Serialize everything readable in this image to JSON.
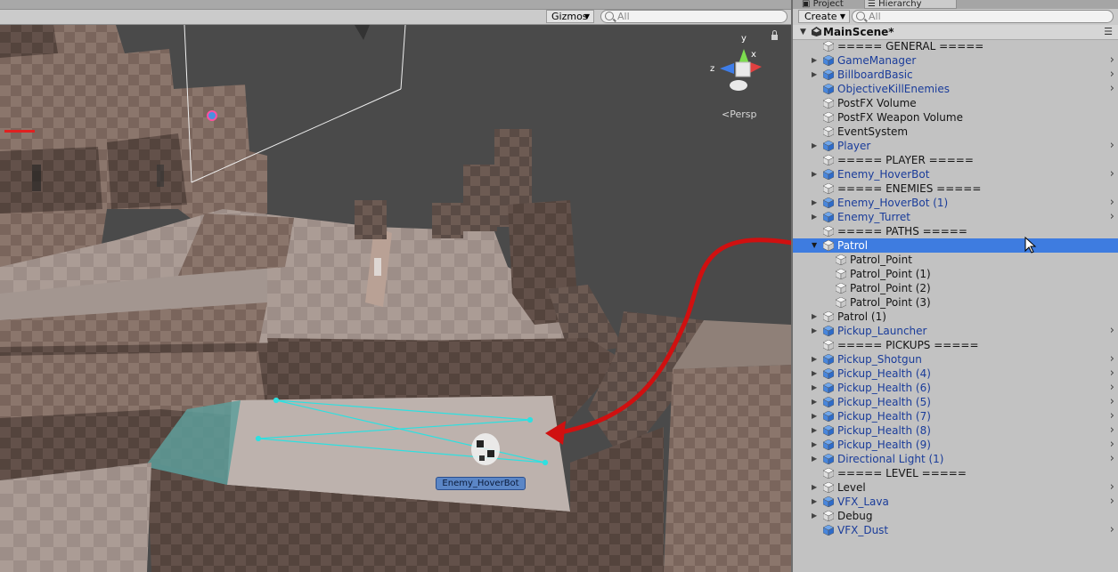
{
  "scene_panel": {
    "gizmos_label": "Gizmos",
    "search_placeholder": "All",
    "persp_label": "Persp",
    "axis_labels": {
      "y": "y",
      "z": "z",
      "x": "x"
    },
    "selected_object_label": "Enemy_HoverBot"
  },
  "hierarchy_panel": {
    "tabs": [
      {
        "label": "Project"
      },
      {
        "label": "Hierarchy"
      }
    ],
    "create_label": "Create",
    "search_placeholder": "All",
    "scene_name": "MainScene*",
    "rows": [
      {
        "label": "===== GENERAL =====",
        "type": "plain",
        "depth": 0,
        "fold": "none",
        "chevron": false,
        "selected": false
      },
      {
        "label": "GameManager",
        "type": "prefab",
        "depth": 0,
        "fold": "closed",
        "chevron": true,
        "selected": false
      },
      {
        "label": "BillboardBasic",
        "type": "prefab",
        "depth": 0,
        "fold": "closed",
        "chevron": true,
        "selected": false
      },
      {
        "label": "ObjectiveKillEnemies",
        "type": "prefab",
        "depth": 0,
        "fold": "none",
        "chevron": true,
        "selected": false
      },
      {
        "label": "PostFX Volume",
        "type": "plain",
        "depth": 0,
        "fold": "none",
        "chevron": false,
        "selected": false
      },
      {
        "label": "PostFX Weapon Volume",
        "type": "plain",
        "depth": 0,
        "fold": "none",
        "chevron": false,
        "selected": false
      },
      {
        "label": "EventSystem",
        "type": "plain",
        "depth": 0,
        "fold": "none",
        "chevron": false,
        "selected": false
      },
      {
        "label": "Player",
        "type": "prefab",
        "depth": 0,
        "fold": "closed",
        "chevron": true,
        "selected": false
      },
      {
        "label": "===== PLAYER =====",
        "type": "plain",
        "depth": 0,
        "fold": "none",
        "chevron": false,
        "selected": false
      },
      {
        "label": "Enemy_HoverBot",
        "type": "prefab",
        "depth": 0,
        "fold": "closed",
        "chevron": true,
        "selected": false
      },
      {
        "label": "===== ENEMIES =====",
        "type": "plain",
        "depth": 0,
        "fold": "none",
        "chevron": false,
        "selected": false
      },
      {
        "label": "Enemy_HoverBot (1)",
        "type": "prefab",
        "depth": 0,
        "fold": "closed",
        "chevron": true,
        "selected": false
      },
      {
        "label": "Enemy_Turret",
        "type": "prefab",
        "depth": 0,
        "fold": "closed",
        "chevron": true,
        "selected": false
      },
      {
        "label": "===== PATHS =====",
        "type": "plain",
        "depth": 0,
        "fold": "none",
        "chevron": false,
        "selected": false
      },
      {
        "label": "Patrol",
        "type": "plain",
        "depth": 0,
        "fold": "open",
        "chevron": false,
        "selected": true
      },
      {
        "label": "Patrol_Point",
        "type": "plain",
        "depth": 1,
        "fold": "none",
        "chevron": false,
        "selected": false
      },
      {
        "label": "Patrol_Point (1)",
        "type": "plain",
        "depth": 1,
        "fold": "none",
        "chevron": false,
        "selected": false
      },
      {
        "label": "Patrol_Point (2)",
        "type": "plain",
        "depth": 1,
        "fold": "none",
        "chevron": false,
        "selected": false
      },
      {
        "label": "Patrol_Point (3)",
        "type": "plain",
        "depth": 1,
        "fold": "none",
        "chevron": false,
        "selected": false
      },
      {
        "label": "Patrol (1)",
        "type": "plain",
        "depth": 0,
        "fold": "closed",
        "chevron": false,
        "selected": false
      },
      {
        "label": "Pickup_Launcher",
        "type": "prefab",
        "depth": 0,
        "fold": "closed",
        "chevron": true,
        "selected": false
      },
      {
        "label": "===== PICKUPS =====",
        "type": "plain",
        "depth": 0,
        "fold": "none",
        "chevron": false,
        "selected": false
      },
      {
        "label": "Pickup_Shotgun",
        "type": "prefab",
        "depth": 0,
        "fold": "closed",
        "chevron": true,
        "selected": false
      },
      {
        "label": "Pickup_Health (4)",
        "type": "prefab",
        "depth": 0,
        "fold": "closed",
        "chevron": true,
        "selected": false
      },
      {
        "label": "Pickup_Health (6)",
        "type": "prefab",
        "depth": 0,
        "fold": "closed",
        "chevron": true,
        "selected": false
      },
      {
        "label": "Pickup_Health (5)",
        "type": "prefab",
        "depth": 0,
        "fold": "closed",
        "chevron": true,
        "selected": false
      },
      {
        "label": "Pickup_Health (7)",
        "type": "prefab",
        "depth": 0,
        "fold": "closed",
        "chevron": true,
        "selected": false
      },
      {
        "label": "Pickup_Health (8)",
        "type": "prefab",
        "depth": 0,
        "fold": "closed",
        "chevron": true,
        "selected": false
      },
      {
        "label": "Pickup_Health (9)",
        "type": "prefab",
        "depth": 0,
        "fold": "closed",
        "chevron": true,
        "selected": false
      },
      {
        "label": "Directional Light (1)",
        "type": "prefab",
        "depth": 0,
        "fold": "closed",
        "chevron": true,
        "selected": false
      },
      {
        "label": "===== LEVEL =====",
        "type": "plain",
        "depth": 0,
        "fold": "none",
        "chevron": false,
        "selected": false
      },
      {
        "label": "Level",
        "type": "plain",
        "depth": 0,
        "fold": "closed",
        "chevron": true,
        "selected": false
      },
      {
        "label": "VFX_Lava",
        "type": "prefab",
        "depth": 0,
        "fold": "closed",
        "chevron": true,
        "selected": false
      },
      {
        "label": "Debug",
        "type": "plain",
        "depth": 0,
        "fold": "closed",
        "chevron": false,
        "selected": false
      },
      {
        "label": "VFX_Dust",
        "type": "prefab",
        "depth": 0,
        "fold": "none",
        "chevron": true,
        "selected": false
      }
    ]
  },
  "colors": {
    "selection": "#3e7ce0",
    "prefab_text": "#1a3c9a",
    "patrol_path": "#2ee0e0",
    "annotation_arrow": "#d01010",
    "scene_background": "#4a4a4a"
  }
}
